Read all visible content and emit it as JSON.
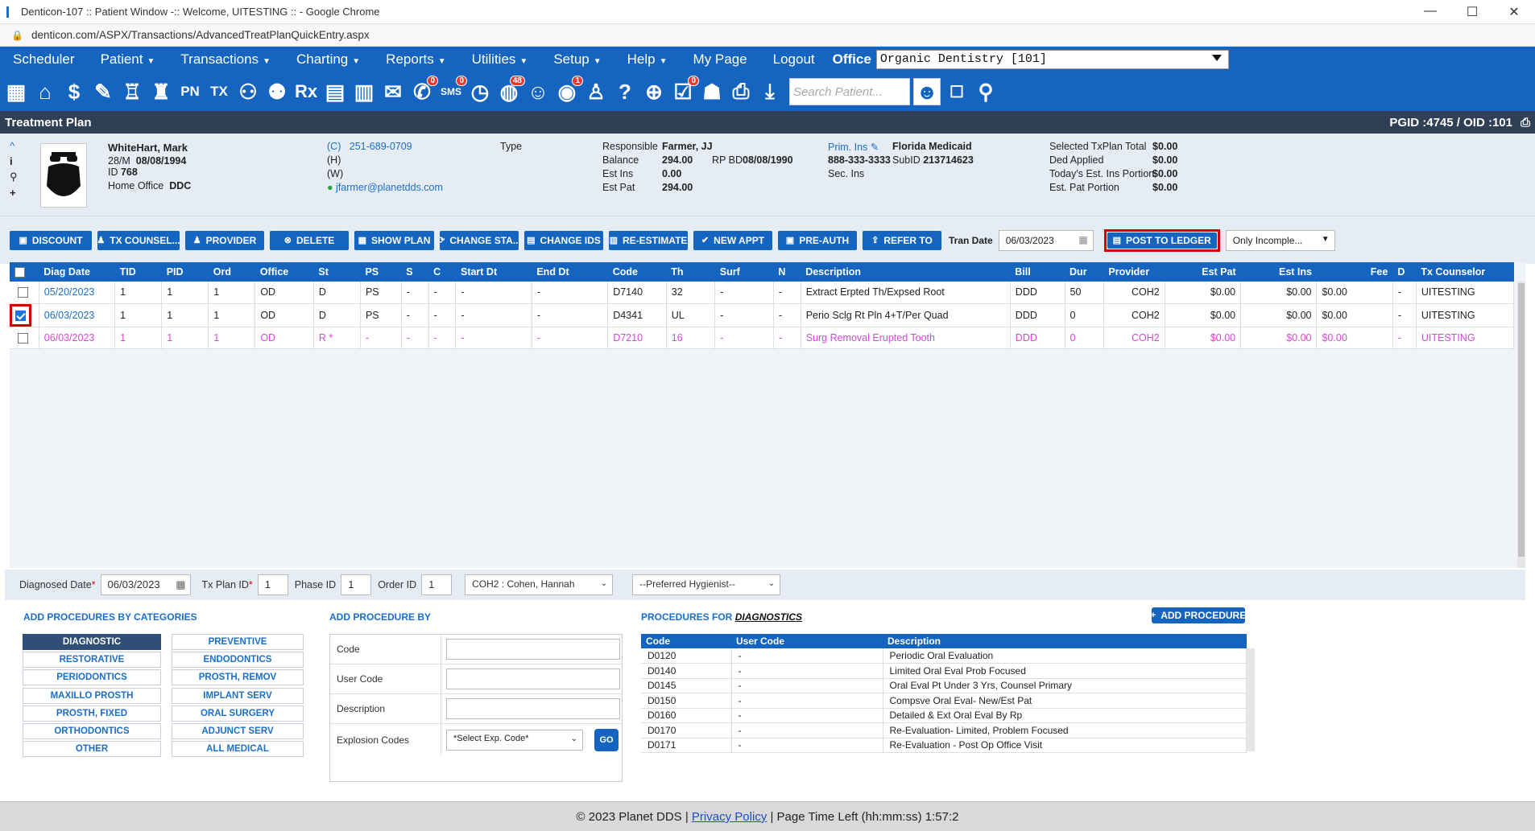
{
  "window": {
    "title": "Denticon-107 :: Patient Window -:: Welcome, UITESTING :: - Google Chrome",
    "url": "denticon.com/ASPX/Transactions/AdvancedTreatPlanQuickEntry.aspx"
  },
  "menu": {
    "items": [
      "Scheduler",
      "Patient",
      "Transactions",
      "Charting",
      "Reports",
      "Utilities",
      "Setup",
      "Help",
      "My Page",
      "Logout"
    ],
    "office_label": "Office",
    "office_value": "Organic Dentistry [101]"
  },
  "iconbar": {
    "search_placeholder": "Search Patient...",
    "icons": [
      "calendar-icon",
      "home-icon",
      "dollar-icon",
      "edit-icon",
      "tooth-icon",
      "teeth-icon",
      "pn-icon",
      "tx-icon",
      "patient-add-icon",
      "family-add-icon",
      "rx-icon",
      "notes-icon",
      "printer-doc-icon",
      "mail-icon",
      "message-icon",
      "sms-icon",
      "clock-icon",
      "globe-icon",
      "support-icon",
      "alert-icon",
      "tooth-outline-icon",
      "tooth-question-icon",
      "web-icon",
      "checklist-icon",
      "group-icon",
      "print-icon",
      "download-icon"
    ],
    "badges": {
      "message-icon": "0",
      "sms-icon": "0",
      "globe-icon": "48",
      "alert-icon": "1",
      "checklist-icon": "0"
    },
    "icon_text": {
      "pn-icon": "PN",
      "tx-icon": "TX",
      "rx-icon": "Rx",
      "sms-icon": "SMS"
    }
  },
  "header": {
    "title": "Treatment Plan",
    "pgid": "PGID :4745  /  OID :101"
  },
  "patient": {
    "name": "WhiteHart, Mark",
    "age_sex": "28/M",
    "dob": "08/08/1994",
    "id_label": "ID",
    "id": "768",
    "home_office_label": "Home Office",
    "home_office": "DDC",
    "phone_c_label": "(C)",
    "phone_c": "251-689-0709",
    "phone_h_label": "(H)",
    "phone_w_label": "(W)",
    "email": "jfarmer@planetdds.com",
    "type_label": "Type",
    "responsible_label": "Responsible",
    "responsible": "Farmer, JJ",
    "balance_label": "Balance",
    "balance": "294.00",
    "rpbd_label": "RP BD",
    "rpbd": "08/08/1990",
    "estins_label": "Est Ins",
    "estins": "0.00",
    "estpat_label": "Est Pat",
    "estpat": "294.00",
    "primins_label": "Prim. Ins",
    "primins": "Florida Medicaid",
    "ins_phone": "888-333-3333",
    "subid_label": "SubID",
    "subid": "213714623",
    "secins_label": "Sec. Ins",
    "selected_label": "Selected TxPlan Total",
    "selected": "$0.00",
    "ded_label": "Ded Applied",
    "ded": "$0.00",
    "today_label": "Today's Est. Ins Portion",
    "today": "$0.00",
    "estpatp_label": "Est. Pat Portion",
    "estpatp": "$0.00"
  },
  "toolbar": {
    "buttons": [
      "DISCOUNT",
      "TX COUNSEL...",
      "PROVIDER",
      "DELETE",
      "SHOW PLAN",
      "CHANGE STA...",
      "CHANGE IDS",
      "RE-ESTIMATE",
      "NEW APPT",
      "PRE-AUTH",
      "REFER TO"
    ],
    "tran_date_label": "Tran Date",
    "tran_date": "06/03/2023",
    "post_ledger": "POST TO LEDGER",
    "filter": "Only Incomple..."
  },
  "grid": {
    "columns": [
      "",
      "Diag Date",
      "TID",
      "PID",
      "Ord",
      "Office",
      "St",
      "PS",
      "S",
      "C",
      "Start Dt",
      "End Dt",
      "Code",
      "Th",
      "Surf",
      "N",
      "Description",
      "Bill",
      "Dur",
      "Provider",
      "Est Pat",
      "Est Ins",
      "Fee",
      "D",
      "Tx Counselor"
    ],
    "rows": [
      {
        "checked": false,
        "style": "normal",
        "cells": [
          "05/20/2023",
          "1",
          "1",
          "1",
          "OD",
          "D",
          "PS",
          "-",
          "-",
          "-",
          "-",
          "D7140",
          "32",
          "-",
          "-",
          "Extract Erpted Th/Expsed Root",
          "DDD",
          "50",
          "COH2",
          "$0.00",
          "$0.00",
          "$0.00",
          "-",
          "UITESTING"
        ]
      },
      {
        "checked": true,
        "style": "normal",
        "cells": [
          "06/03/2023",
          "1",
          "1",
          "1",
          "OD",
          "D",
          "PS",
          "-",
          "-",
          "-",
          "-",
          "D4341",
          "UL",
          "-",
          "-",
          "Perio Sclg Rt Pln 4+T/Per Quad",
          "DDD",
          "0",
          "COH2",
          "$0.00",
          "$0.00",
          "$0.00",
          "-",
          "UITESTING"
        ]
      },
      {
        "checked": false,
        "style": "magenta",
        "cells": [
          "06/03/2023",
          "1",
          "1",
          "1",
          "OD",
          "R *",
          "-",
          "-",
          "-",
          "-",
          "-",
          "D7210",
          "16",
          "-",
          "-",
          "Surg Removal Erupted Tooth",
          "DDD",
          "0",
          "COH2",
          "$0.00",
          "$0.00",
          "$0.00",
          "-",
          "UITESTING"
        ]
      }
    ]
  },
  "diag": {
    "diag_date_label": "Diagnosed Date",
    "diag_date": "06/03/2023",
    "txplan_label": "Tx Plan ID",
    "txplan": "1",
    "phase_label": "Phase ID",
    "phase": "1",
    "order_label": "Order ID",
    "order": "1",
    "provider": "COH2 : Cohen, Hannah",
    "hygienist": "--Preferred Hygienist--"
  },
  "categories": {
    "title": "ADD PROCEDURES BY CATEGORIES",
    "left": [
      "DIAGNOSTIC",
      "RESTORATIVE",
      "PERIODONTICS",
      "MAXILLO PROSTH",
      "PROSTH, FIXED",
      "ORTHODONTICS",
      "OTHER"
    ],
    "right": [
      "PREVENTIVE",
      "ENDODONTICS",
      "PROSTH, REMOV",
      "IMPLANT SERV",
      "ORAL SURGERY",
      "ADJUNCT SERV",
      "ALL MEDICAL"
    ]
  },
  "addby": {
    "title": "ADD PROCEDURE BY",
    "code_label": "Code",
    "user_code_label": "User Code",
    "desc_label": "Description",
    "explosion_label": "Explosion Codes",
    "explosion_value": "*Select Exp. Code*",
    "go": "GO"
  },
  "procs": {
    "title_prefix": "PROCEDURES FOR",
    "title_cat": "DIAGNOSTICS",
    "add_btn": "ADD PROCEDURE",
    "columns": [
      "Code",
      "User Code",
      "Description"
    ],
    "rows": [
      [
        "D0120",
        "-",
        "Periodic Oral Evaluation"
      ],
      [
        "D0140",
        "-",
        "Limited Oral Eval Prob Focused"
      ],
      [
        "D0145",
        "-",
        "Oral Eval Pt Under 3 Yrs, Counsel Primary"
      ],
      [
        "D0150",
        "-",
        "Compsve Oral Eval- New/Est Pat"
      ],
      [
        "D0160",
        "-",
        "Detailed & Ext Oral Eval By Rp"
      ],
      [
        "D0170",
        "-",
        "Re-Evaluation- Limited, Problem Focused"
      ],
      [
        "D0171",
        "-",
        "Re-Evaluation - Post Op Office Visit"
      ]
    ]
  },
  "footer": {
    "copy": "© 2023 Planet DDS |",
    "privacy": "Privacy Policy",
    "time": "| Page Time Left (hh:mm:ss) 1:57:2"
  }
}
